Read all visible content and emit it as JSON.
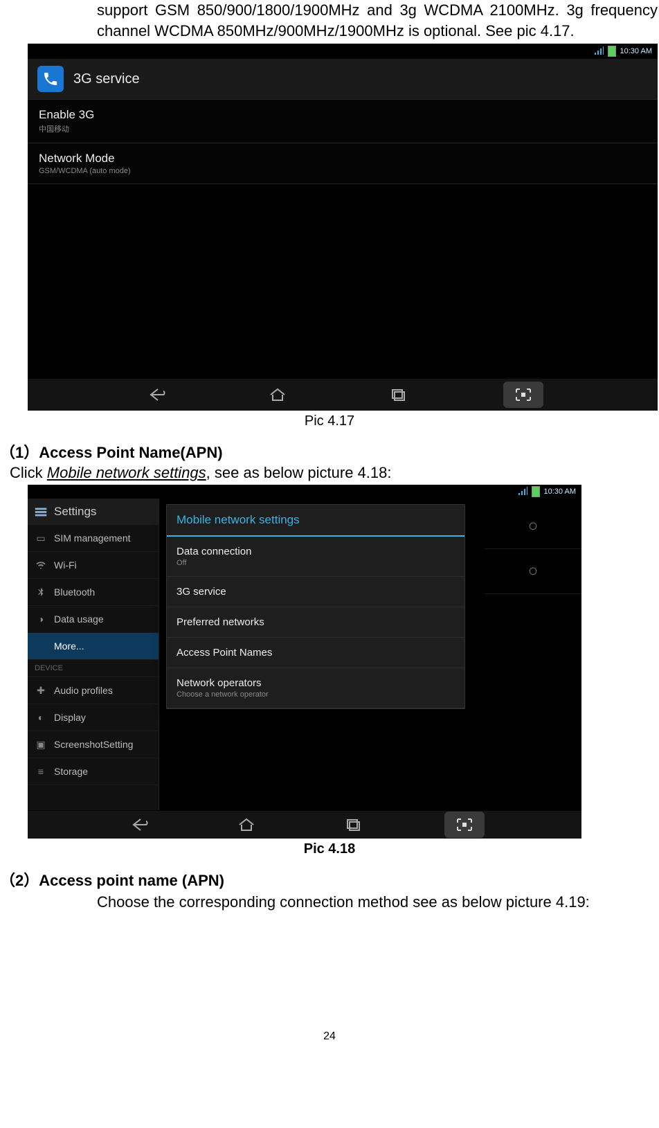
{
  "para_top": "support GSM 850/900/1800/1900MHz and 3g WCDMA 2100MHz. 3g frequency channel WCDMA 850MHz/900MHz/1900MHz is optional. See pic 4.17.",
  "pic417_caption": "Pic 4.17",
  "sec1_title": "（1）Access Point Name(APN)",
  "sec1_line_pre": "Click ",
  "sec1_line_ital": "Mobile network settings",
  "sec1_line_post": ", see as below picture 4.18:",
  "pic418_caption": "Pic 4.18",
  "sec2_title": "（2）Access point name (APN)",
  "sec2_para": "Choose the corresponding connection method see as below picture 4.19:",
  "page_number": "24",
  "shot1": {
    "status_time": "10:30 AM",
    "hdr_title": "3G service",
    "rows": [
      {
        "title": "Enable 3G",
        "sub": "中国移动"
      },
      {
        "title": "Network Mode",
        "sub": "GSM/WCDMA (auto mode)"
      }
    ]
  },
  "shot2": {
    "status_time": "10:30 AM",
    "settings_title": "Settings",
    "left": {
      "items": [
        {
          "label": "SIM management"
        },
        {
          "label": "Wi-Fi"
        },
        {
          "label": "Bluetooth"
        },
        {
          "label": "Data usage"
        },
        {
          "label": "More..."
        }
      ],
      "device_header": "DEVICE",
      "device_items": [
        {
          "label": "Audio profiles"
        },
        {
          "label": "Display"
        },
        {
          "label": "ScreenshotSetting"
        },
        {
          "label": "Storage"
        }
      ]
    },
    "dialog": {
      "title": "Mobile network settings",
      "rows": [
        {
          "title": "Data connection",
          "sub": "Off"
        },
        {
          "title": "3G service",
          "sub": ""
        },
        {
          "title": "Preferred networks",
          "sub": ""
        },
        {
          "title": "Access Point Names",
          "sub": ""
        },
        {
          "title": "Network operators",
          "sub": "Choose a network operator"
        }
      ]
    }
  }
}
